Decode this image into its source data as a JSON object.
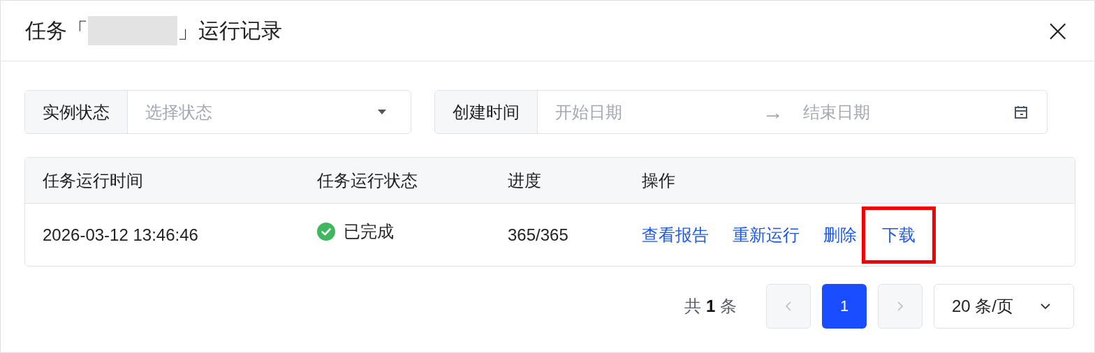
{
  "dialog": {
    "title_prefix": "任务「",
    "title_suffix": "」运行记录",
    "title_redacted": true,
    "close": "×"
  },
  "filters": [
    {
      "kind": "select",
      "label": "实例状态",
      "placeholder": "选择状态"
    },
    {
      "kind": "daterange",
      "label": "创建时间",
      "start_placeholder": "开始日期",
      "separator": "→",
      "end_placeholder": "结束日期"
    }
  ],
  "table": {
    "columns": [
      "任务运行时间",
      "任务运行状态",
      "进度",
      "操作"
    ],
    "rows": [
      {
        "time": "2026-03-12 13:46:46",
        "status": "已完成",
        "completed": true,
        "progress": "365/365",
        "actions": [
          {
            "label": "查看报告",
            "highlighted": false
          },
          {
            "label": "重新运行",
            "highlighted": false
          },
          {
            "label": "删除",
            "highlighted": false
          },
          {
            "label": "下载",
            "highlighted": true
          }
        ]
      }
    ]
  },
  "pagination": {
    "total": "共 **1** 条",
    "prev_disabled": true,
    "next_disabled": true,
    "pages": [
      {
        "label": "1",
        "selected": true
      }
    ],
    "page_size": "20 条/页"
  }
}
